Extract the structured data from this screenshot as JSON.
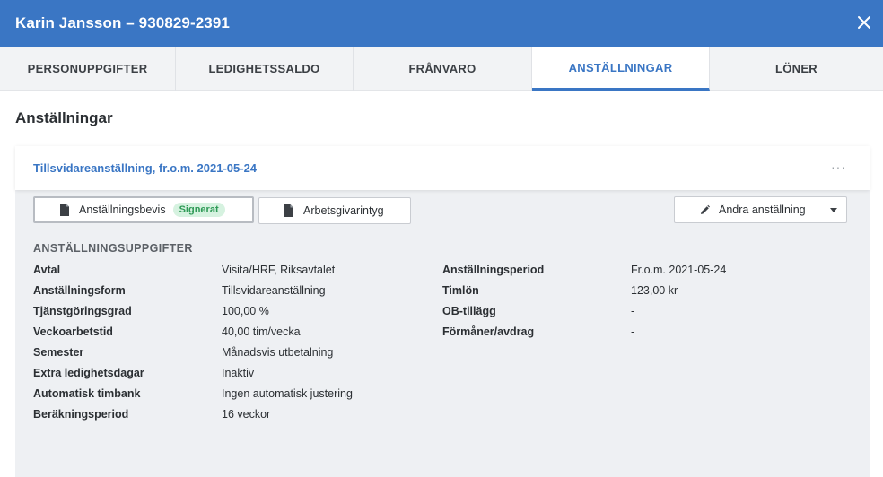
{
  "window": {
    "title": "Karin Jansson – 930829-2391"
  },
  "tabs": [
    {
      "label": "PERSONUPPGIFTER"
    },
    {
      "label": "LEDIGHETSSALDO"
    },
    {
      "label": "FRÅNVARO"
    },
    {
      "label": "ANSTÄLLNINGAR"
    },
    {
      "label": "LÖNER"
    }
  ],
  "page": {
    "heading": "Anställningar"
  },
  "card": {
    "title_link": "Tillsvidareanställning, fr.o.m. 2021-05-24",
    "more_label": "···",
    "buttons": {
      "bevis": "Anställningsbevis",
      "bevis_badge": "Signerat",
      "intyg": "Arbetsgivarintyg",
      "andra": "Ändra anställning"
    },
    "section_title": "ANSTÄLLNINGSUPPGIFTER",
    "left_fields": [
      {
        "label": "Avtal",
        "value": "Visita/HRF, Riksavtalet"
      },
      {
        "label": "Anställningsform",
        "value": "Tillsvidareanställning"
      },
      {
        "label": "Tjänstgöringsgrad",
        "value": "100,00 %"
      },
      {
        "label": "Veckoarbetstid",
        "value": "40,00 tim/vecka"
      },
      {
        "label": "Semester",
        "value": "Månadsvis utbetalning"
      },
      {
        "label": "Extra ledighetsdagar",
        "value": "Inaktiv"
      },
      {
        "label": "Automatisk timbank",
        "value": "Ingen automatisk justering"
      },
      {
        "label": "Beräkningsperiod",
        "value": "16 veckor"
      }
    ],
    "right_fields": [
      {
        "label": "Anställningsperiod",
        "value": "Fr.o.m. 2021-05-24"
      },
      {
        "label": "Timlön",
        "value": "123,00 kr"
      },
      {
        "label": "OB-tillägg",
        "value": "-"
      },
      {
        "label": "Förmåner/avdrag",
        "value": "-"
      }
    ]
  },
  "colors": {
    "accent": "#3a76c4",
    "badge_bg": "#d6f2e0",
    "badge_text": "#2e9a56",
    "card_bg": "#eef0f3"
  }
}
